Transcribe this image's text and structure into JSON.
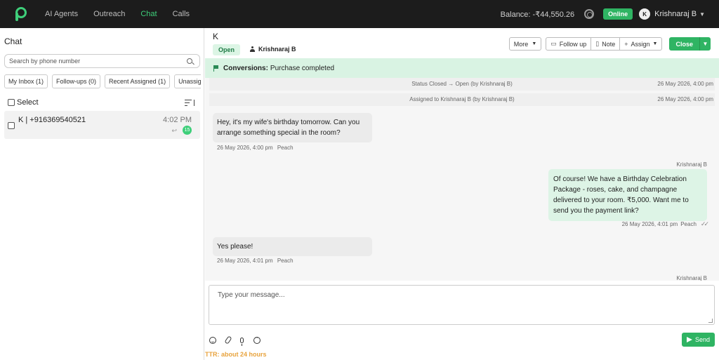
{
  "nav": {
    "items": [
      "AI Agents",
      "Outreach",
      "Chat",
      "Calls"
    ],
    "active_index": 2,
    "balance": "Balance: -₹44,550.26",
    "status": "Online",
    "user_initial": "K",
    "user_name": "Krishnaraj B"
  },
  "sidebar": {
    "title": "Chat",
    "search_placeholder": "Search by phone number",
    "filters": [
      "My Inbox (1)",
      "Follow-ups (0)",
      "Recent Assigned (1)",
      "Unassigned"
    ],
    "select_label": "Select",
    "conversations": [
      {
        "name": "K | +916369540521",
        "time": "4:02 PM",
        "unread": "15"
      }
    ]
  },
  "header": {
    "contact_name": "K",
    "status": "Open",
    "assignee": "Krishnaraj B",
    "buttons": {
      "more": "More",
      "follow_up": "Follow up",
      "note": "Note",
      "assign": "Assign",
      "close": "Close"
    }
  },
  "banner": {
    "label": "Conversions:",
    "text": "Purchase completed"
  },
  "messages": {
    "system": [
      {
        "text": "Status Closed → Open (by Krishnaraj B)",
        "time": "26 May 2026, 4:00 pm"
      },
      {
        "text": "Assigned to Krishnaraj B (by Krishnaraj B)",
        "time": "26 May 2026, 4:00 pm"
      }
    ],
    "thread": [
      {
        "direction": "in",
        "text": "Hey, it's my wife's birthday tomorrow. Can you arrange something special in the room?",
        "time": "26 May 2026, 4:00 pm",
        "channel": "Peach"
      },
      {
        "direction": "out",
        "sender": "Krishnaraj B",
        "text": "Of course! We have a Birthday Celebration Package - roses, cake, and champagne delivered to your room. ₹5,000. Want me to send you the payment link?",
        "time": "26 May 2026, 4:01 pm",
        "channel": "Peach"
      },
      {
        "direction": "in",
        "text": "Yes please!",
        "time": "26 May 2026, 4:01 pm",
        "channel": "Peach"
      },
      {
        "direction": "out",
        "sender": "Krishnaraj B"
      }
    ]
  },
  "composer": {
    "placeholder": "Type your message...",
    "send_label": "Send",
    "ttr": "TTR: about 24 hours"
  },
  "colors": {
    "accent": "#2fb463",
    "banner_bg": "#d9f3e3",
    "ttr": "#e8a33d"
  }
}
